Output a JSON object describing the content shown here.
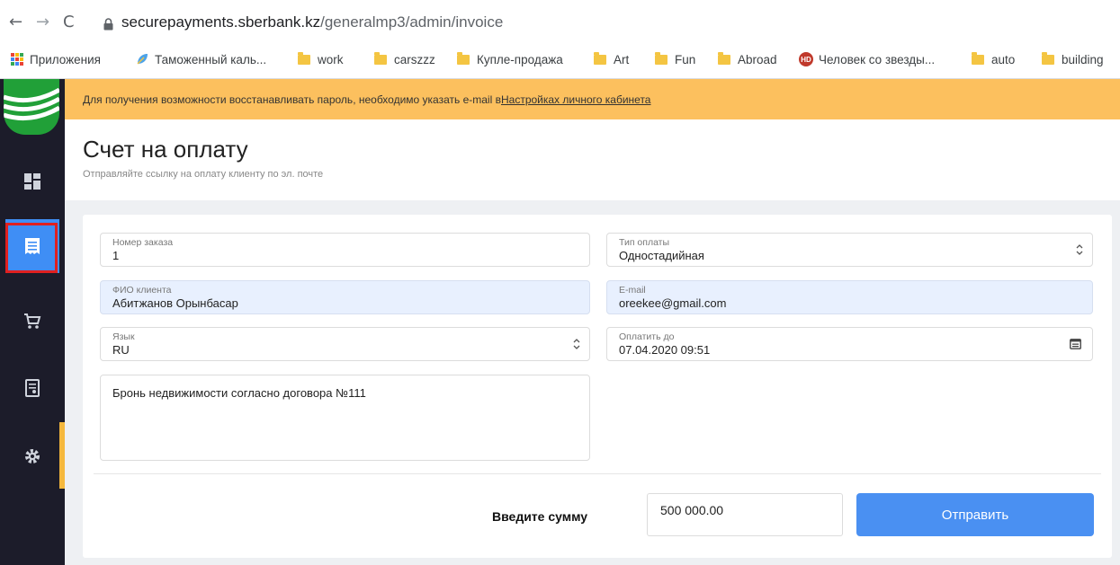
{
  "browser": {
    "url_host": "securepayments.sberbank.kz",
    "url_path": "/generalmp3/admin/invoice"
  },
  "bookmarks": [
    {
      "label": "Приложения",
      "icon": "apps-grid-icon"
    },
    {
      "label": "Таможенный каль...",
      "icon": "leaf-icon"
    },
    {
      "label": "work",
      "icon": "folder-icon"
    },
    {
      "label": "carszzz",
      "icon": "folder-icon"
    },
    {
      "label": "Купле-продажа",
      "icon": "folder-icon"
    },
    {
      "label": "Art",
      "icon": "folder-icon"
    },
    {
      "label": "Fun",
      "icon": "folder-icon"
    },
    {
      "label": "Abroad",
      "icon": "folder-icon"
    },
    {
      "label": "Человек со звезды...",
      "icon": "hd-icon"
    },
    {
      "label": "auto",
      "icon": "folder-icon"
    },
    {
      "label": "building",
      "icon": "folder-icon"
    }
  ],
  "hd_icon_text": "HD",
  "sidebar": {
    "items": [
      {
        "name": "dashboard",
        "icon": "dashboard-icon"
      },
      {
        "name": "invoice",
        "icon": "invoice-icon",
        "active": true
      },
      {
        "name": "cart",
        "icon": "cart-icon"
      },
      {
        "name": "receipt",
        "icon": "receipt-icon"
      },
      {
        "name": "settings",
        "icon": "gear-icon"
      }
    ]
  },
  "banner": {
    "text": "Для получения возможности восстанавливать пароль, необходимо указать e-mail в ",
    "link": "Настройках личного кабинета"
  },
  "page": {
    "title": "Счет на оплату",
    "subtitle": "Отправляйте ссылку на оплату клиенту по эл. почте"
  },
  "form": {
    "order_number": {
      "label": "Номер заказа",
      "value": "1"
    },
    "payment_type": {
      "label": "Тип оплаты",
      "value": "Одностадийная"
    },
    "client_name": {
      "label": "ФИО клиента",
      "value": "Абитжанов Орынбасар"
    },
    "email": {
      "label": "E-mail",
      "value": "oreekee@gmail.com"
    },
    "language": {
      "label": "Язык",
      "value": "RU"
    },
    "pay_until": {
      "label": "Оплатить до",
      "value": "07.04.2020 09:51"
    },
    "description": "Бронь недвижимости согласно договора №111",
    "amount_label": "Введите сумму",
    "amount_value": "500 000.00",
    "submit_label": "Отправить"
  },
  "colors": {
    "sidebar_bg": "#1c1c2a",
    "sidebar_active": "#3f8ef5",
    "banner_bg": "#fcc05e",
    "button_bg": "#4a90f2",
    "logo_green": "#21a038"
  }
}
